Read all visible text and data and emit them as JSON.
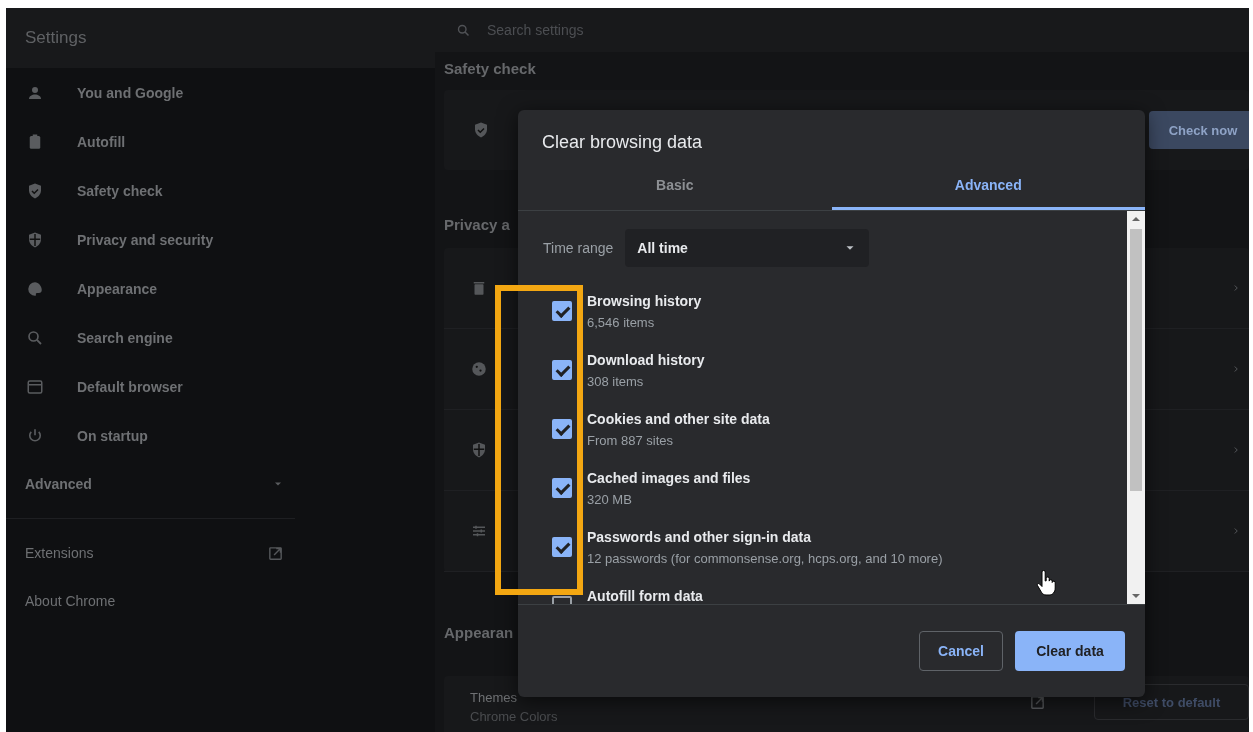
{
  "sidebar": {
    "title": "Settings",
    "items": [
      {
        "label": "You and Google"
      },
      {
        "label": "Autofill"
      },
      {
        "label": "Safety check"
      },
      {
        "label": "Privacy and security"
      },
      {
        "label": "Appearance"
      },
      {
        "label": "Search engine"
      },
      {
        "label": "Default browser"
      },
      {
        "label": "On startup"
      }
    ],
    "advanced": {
      "label": "Advanced",
      "expanded": false
    },
    "links": [
      {
        "label": "Extensions",
        "kind": "external"
      },
      {
        "label": "About Chrome",
        "kind": "internal"
      }
    ]
  },
  "search": {
    "placeholder": "Search settings"
  },
  "safety_check": {
    "heading": "Safety check",
    "button": "Check now"
  },
  "privacy": {
    "heading": "Privacy a"
  },
  "appearance": {
    "heading": "Appearan",
    "row": {
      "title": "Themes",
      "subtitle": "Chrome Colors",
      "button": "Reset to default"
    }
  },
  "dialog": {
    "title": "Clear browsing data",
    "tabs": [
      {
        "label": "Basic",
        "selected": false
      },
      {
        "label": "Advanced",
        "selected": true
      }
    ],
    "time_range": {
      "label": "Time range",
      "value": "All time"
    },
    "items": [
      {
        "title": "Browsing history",
        "detail": "6,546 items",
        "checked": true
      },
      {
        "title": "Download history",
        "detail": "308 items",
        "checked": true
      },
      {
        "title": "Cookies and other site data",
        "detail": "From 887 sites",
        "checked": true
      },
      {
        "title": "Cached images and files",
        "detail": "320 MB",
        "checked": true
      },
      {
        "title": "Passwords and other sign-in data",
        "detail": "12 passwords (for commonsense.org, hcps.org, and 10 more)",
        "checked": true
      },
      {
        "title": "Autofill form data",
        "checked": false
      }
    ],
    "buttons": [
      {
        "label": "Cancel",
        "kind": "secondary"
      },
      {
        "label": "Clear data",
        "kind": "primary"
      }
    ]
  }
}
